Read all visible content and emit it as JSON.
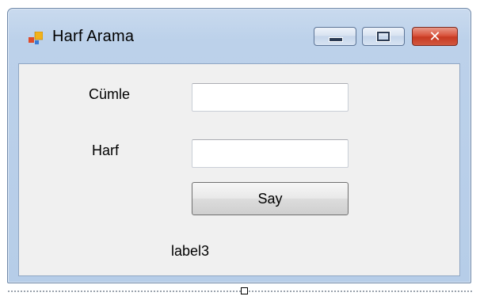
{
  "window": {
    "title": "Harf Arama",
    "icon": "winforms-app-icon"
  },
  "caption_buttons": {
    "minimize_icon": "minimize-icon",
    "maximize_icon": "maximize-icon",
    "close_glyph": "✕"
  },
  "form": {
    "sentence_label": "Cümle",
    "sentence_value": "",
    "letter_label": "Harf",
    "letter_value": "",
    "count_button_label": "Say",
    "result_label": "label3"
  },
  "colors": {
    "titlebar": "#bcd1ea",
    "client": "#f0f0f0",
    "close_button": "#c73a22"
  }
}
